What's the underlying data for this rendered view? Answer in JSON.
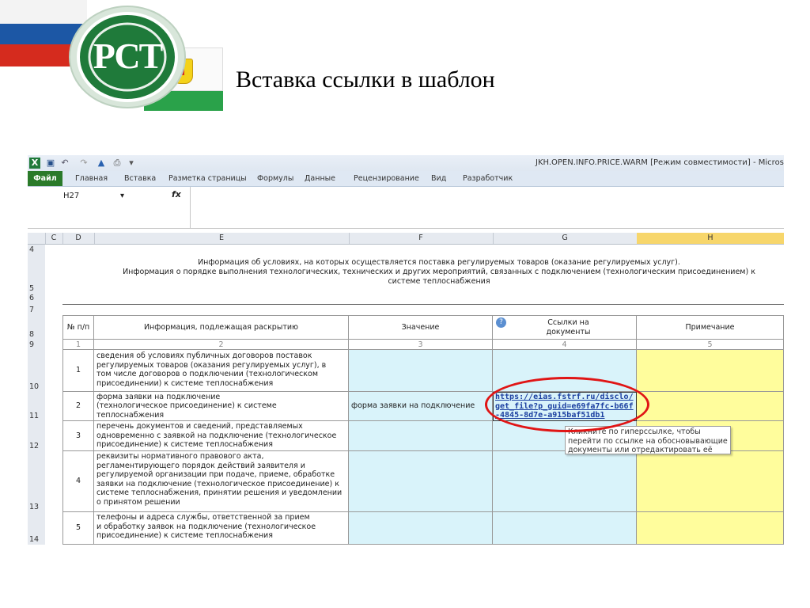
{
  "slide": {
    "title": "Вставка ссылки в шаблон",
    "logo_text": "РСТ",
    "colors": {
      "green": "#1f7a3a",
      "flag_red": "#d52b1e",
      "flag_blue": "#1c57a5"
    }
  },
  "excel": {
    "window_title": "JKH.OPEN.INFO.PRICE.WARM  [Режим совместимости] - Microsoft E",
    "tabs": [
      "Файл",
      "Главная",
      "Вставка",
      "Разметка страницы",
      "Формулы",
      "Данные",
      "Рецензирование",
      "Вид",
      "Разработчик"
    ],
    "name_box": "H27",
    "fx_label": "fx",
    "columns": [
      "C",
      "D",
      "E",
      "F",
      "G",
      "H"
    ],
    "row_numbers": [
      "4",
      "5",
      "6",
      "7",
      "8",
      "9",
      "10",
      "11",
      "12",
      "13",
      "14"
    ],
    "header_title_line1": "Информация об условиях, на которых осуществляется поставка регулируемых товаров (оказание регулируемых услуг).",
    "header_title_line2": "Информация о порядке выполнения технологических, технических и других мероприятий, связанных с подключением (технологическим присоединением) к системе теплоснабжения",
    "table_headers": {
      "num": "№ п/п",
      "info": "Информация, подлежащая раскрытию",
      "value": "Значение",
      "links": "Ссылки на документы",
      "note": "Примечание"
    },
    "col_numbers": [
      "1",
      "2",
      "3",
      "4",
      "5"
    ],
    "rows": [
      {
        "num": "1",
        "info": "сведения об условиях публичных договоров поставок регулируемых товаров (оказания регулируемых услуг), в том числе договоров о подключении (технологическом присоединении) к системе теплоснабжения",
        "value": "",
        "link": ""
      },
      {
        "num": "2",
        "info": "форма заявки на подключение (технологическое присоединение) к системе теплоснабжения",
        "value": "форма заявки на подключение",
        "link": "https://eias.fstrf.ru/disclo/get_file?p_guid=e69fa7fc-b66f-4845-8d7e-a915baf51db1"
      },
      {
        "num": "3",
        "info": "перечень документов и сведений, представляемых одновременно с заявкой на подключение (технологическое присоединение) к системе теплоснабжения",
        "value": "",
        "link": ""
      },
      {
        "num": "4",
        "info": "реквизиты нормативного правового акта, регламентирующего порядок действий заявителя и регулируемой организации при подаче, приеме, обработке заявки на подключение (технологическое присоединение) к системе теплоснабжения, принятии решения и уведомлении о принятом решении",
        "value": "",
        "link": ""
      },
      {
        "num": "5",
        "info": "телефоны и адреса службы, ответственной за прием и обработку заявок на подключение (технологическое присоединение) к системе теплоснабжения",
        "value": "",
        "link": ""
      }
    ],
    "tooltip": "Кликните по гиперссылке, чтобы перейти по ссылке на обосновывающие документы или отредактировать её"
  }
}
